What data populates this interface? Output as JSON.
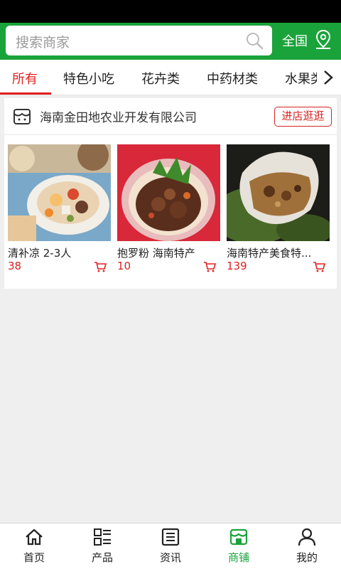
{
  "search": {
    "placeholder": "搜索商家"
  },
  "region": {
    "label": "全国"
  },
  "categories": [
    {
      "label": "所有",
      "active": true
    },
    {
      "label": "特色小吃"
    },
    {
      "label": "花卉类"
    },
    {
      "label": "中药材类"
    },
    {
      "label": "水果类"
    }
  ],
  "shop": {
    "name": "海南金田地农业开发有限公司",
    "visit_label": "进店逛逛",
    "products": [
      {
        "name": "清补凉 2-3人",
        "price": "38"
      },
      {
        "name": "抱罗粉 海南特产",
        "price": "10"
      },
      {
        "name": "海南特产美食特...",
        "price": "139"
      }
    ]
  },
  "tabbar": [
    {
      "label": "首页",
      "icon": "home-icon"
    },
    {
      "label": "产品",
      "icon": "product-list-icon"
    },
    {
      "label": "资讯",
      "icon": "news-icon"
    },
    {
      "label": "商铺",
      "icon": "store-icon",
      "active": true
    },
    {
      "label": "我的",
      "icon": "profile-icon"
    }
  ],
  "colors": {
    "brand_green": "#1aa33a",
    "accent_red": "#e02020"
  }
}
